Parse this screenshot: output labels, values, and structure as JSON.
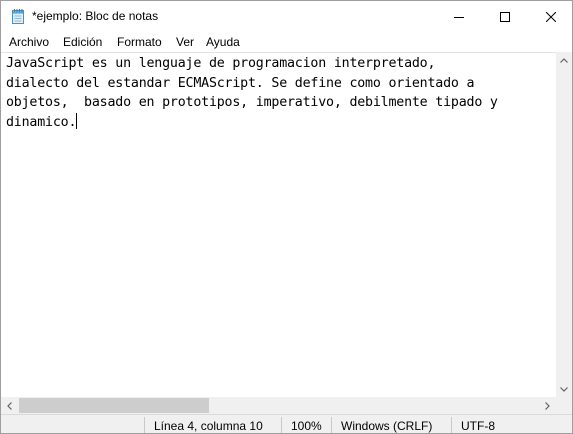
{
  "window": {
    "title": "*ejemplo: Bloc de notas"
  },
  "menu": {
    "items": [
      "Archivo",
      "Edición",
      "Formato",
      "Ver",
      "Ayuda"
    ]
  },
  "editor": {
    "lines": [
      "JavaScript es un lenguaje de programacion interpretado,",
      "dialecto del estandar ECMAScript. Se define como orientado a",
      "objetos,  basado en prototipos, imperativo, debilmente tipado y",
      "dinamico."
    ]
  },
  "statusbar": {
    "position": "Línea 4, columna 10",
    "zoom": "100%",
    "line_ending": "Windows (CRLF)",
    "encoding": "UTF-8"
  },
  "icons": {
    "app": "notepad-icon",
    "minimize": "minimize-icon",
    "maximize": "maximize-icon",
    "close": "close-icon"
  }
}
